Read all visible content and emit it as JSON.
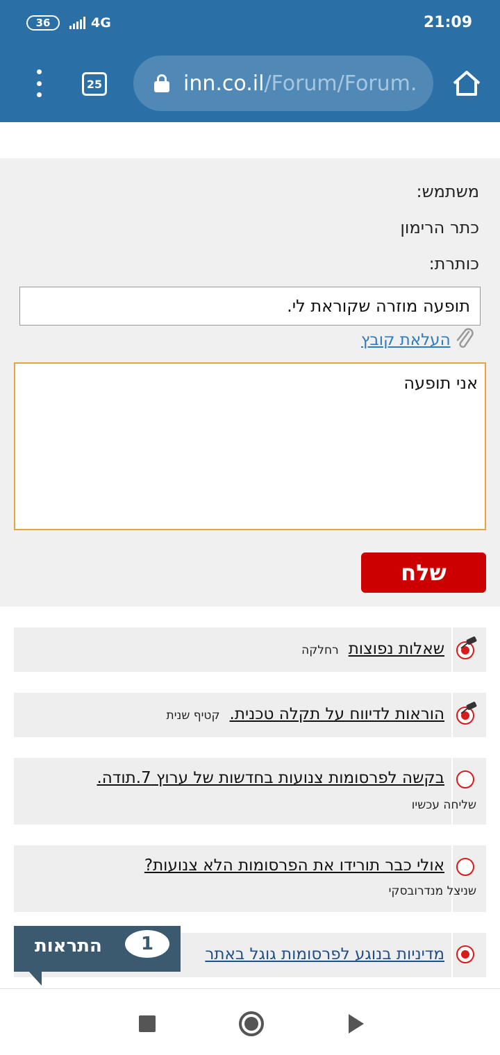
{
  "status_bar": {
    "battery": "36",
    "network": "4G",
    "time": "21:09"
  },
  "browser": {
    "tab_count": "25",
    "url_host": "inn.co.il",
    "url_path": "/Forum/Forum."
  },
  "form": {
    "user_label": "משתמש:",
    "username": "כתר הרימון",
    "title_label": "כותרת:",
    "title_value": "תופעה מוזרה שקוראת לי.",
    "upload_label": "העלאת קובץ",
    "message_value": "אני תופעה",
    "send_label": "שלח"
  },
  "topics": [
    {
      "title": "שאלות נפוצות",
      "author": "רחלקה",
      "pinned": true
    },
    {
      "title": "הוראות לדיווח על תקלה טכנית.",
      "author": "קטיף שנית",
      "pinned": true
    },
    {
      "title": "בקשה לפרסומות צנועות בחדשות של ערוץ 7.תודה.",
      "author": "שליחה עכשיו",
      "pinned": false
    },
    {
      "title": "אולי כבר תורידו את הפרסומות הלא צנועות?",
      "author": "שניצל מנדרובסקי",
      "pinned": false
    },
    {
      "title": "מדיניות בנוגע לפרסומות גוגל באתר",
      "author": "",
      "pinned": false
    }
  ],
  "notifications": {
    "label": "התראות",
    "count": "1"
  },
  "colors": {
    "header": "#2a6fa6",
    "send": "#cc0000",
    "radio": "#d81b1b",
    "textarea_border": "#e6a23c"
  }
}
